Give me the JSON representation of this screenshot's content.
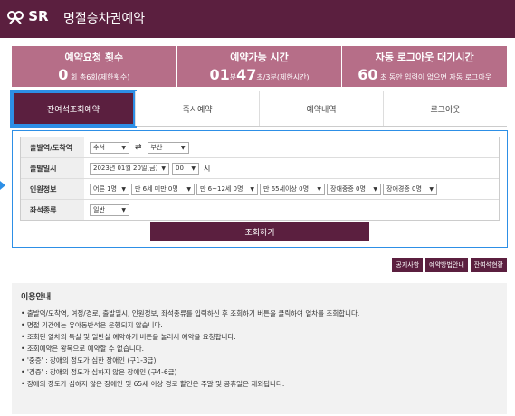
{
  "header": {
    "logo": "SR",
    "title": "명절승차권예약"
  },
  "stats": [
    {
      "title": "예약요청 횟수",
      "value": "0",
      "suffix": "회 총6회(제한횟수)"
    },
    {
      "title": "예약가능 시간",
      "min": "01",
      "sec": "47",
      "suffix": "초/3분(제한시간)",
      "min_unit": "분"
    },
    {
      "title": "자동 로그아웃 대기시간",
      "value": "60",
      "suffix": "초 동안 입력이 없으면 자동 로그아웃"
    }
  ],
  "tabs": [
    "잔여석조회예약",
    "즉시예약",
    "예약내역",
    "로그아웃"
  ],
  "form": {
    "labels": [
      "출발역/도착역",
      "출발일시",
      "인원정보",
      "좌석종류"
    ],
    "dep_station": "수서",
    "arr_station": "부산",
    "date": "2023년 01월 20일(금)",
    "hour": "00",
    "hour_unit": "시",
    "passengers": [
      "어른 1명",
      "만 6세 미만 0명",
      "만 6~12세 0명",
      "만 65세이상 0명",
      "장애중증 0명",
      "장애경증 0명"
    ],
    "seat_type": "일반",
    "search_button": "조회하기"
  },
  "links": [
    "공지사항",
    "예약방법안내",
    "잔여석현황"
  ],
  "info": {
    "title": "이용안내",
    "items": [
      "출발역/도착역, 여정/경로, 출발일시, 인원정보, 좌석종류를 입력하신 후 조회하기 버튼을 클릭하여 열차를 조회합니다.",
      "명절 기간에는 유아동반석은 운행되지 않습니다.",
      "조회된 열차의 특실 및 일반실 예약하기 버튼을 눌러서 예약을 요청합니다.",
      "조회예약은 왕복으로 예약할 수 없습니다.",
      "'중증' : 장애의 정도가 심한 장애인 (구1-3급)",
      "'경증' : 장애의 정도가 심하지 않은 장애인 (구4-6급)",
      "장애의 정도가 심하지 않은 장애인 및 65세 이상 경로 할인은 주말 및 공휴일은 제외됩니다."
    ]
  },
  "colors": {
    "brand": "#5b1f3f",
    "stat_bg": "#b66e88",
    "focus": "#2d8fe6"
  }
}
